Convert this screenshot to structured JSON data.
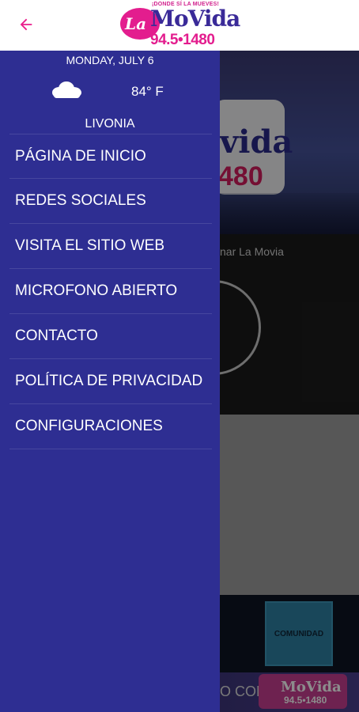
{
  "appbar": {
    "back_icon": "arrow-left-icon",
    "accent_color": "#e91e8c",
    "logo": {
      "tagline": "¡DONDE SÍ LA MUEVES!",
      "la": "La",
      "name": "MoVida",
      "frequency": "94.5•1480"
    }
  },
  "drawer": {
    "background_color": "#2e2e92",
    "date": "MONDAY, JULY 6",
    "weather_icon": "cloud-icon",
    "temperature": "84° F",
    "city": "LIVONIA",
    "items": [
      {
        "label": "PÁGINA DE INICIO"
      },
      {
        "label": "REDES SOCIALES"
      },
      {
        "label": "VISITA EL SITIO WEB"
      },
      {
        "label": "MICROFONO ABIERTO"
      },
      {
        "label": "CONTACTO"
      },
      {
        "label": "POLÍTICA DE PRIVACIDAD"
      },
      {
        "label": "CONFIGURACIONES"
      }
    ]
  },
  "background": {
    "hero_logo_text": "vida",
    "hero_logo_number": "480",
    "now_playing": "nar La Movia",
    "tile_label": "COMUNIDAD",
    "banner_text": "O CON",
    "banner_logo_name": "MoVida",
    "banner_logo_frequency": "94.5•1480"
  }
}
